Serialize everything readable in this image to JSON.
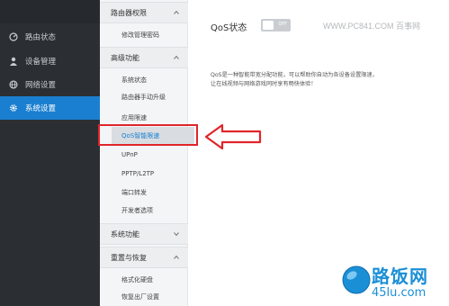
{
  "sidebar": {
    "items": [
      {
        "label": "路由状态",
        "icon": "gauge-icon"
      },
      {
        "label": "设备管理",
        "icon": "user-icon"
      },
      {
        "label": "网络设置",
        "icon": "globe-icon"
      },
      {
        "label": "系统设置",
        "icon": "gear-icon",
        "active": true
      }
    ]
  },
  "menu2": {
    "sections": [
      {
        "title": "路由器权限",
        "items": [
          "修改管理密码"
        ]
      },
      {
        "title": "高级功能",
        "items": [
          "系统状态",
          "路由器手动升级",
          "应用限速",
          "QoS智能限速",
          "UPnP",
          "PPTP/L2TP",
          "端口转发",
          "开发者选项"
        ]
      },
      {
        "title": "系统功能",
        "items": []
      },
      {
        "title": "重置与恢复",
        "items": [
          "格式化硬盘",
          "恢复出厂设置"
        ]
      }
    ],
    "selected": "QoS智能限速"
  },
  "main": {
    "qos_title": "QoS状态",
    "toggle_label": "OFF",
    "desc_line1": "QoS是一种智能带宽分配功能，可以帮助你自动为各设备设置限速，",
    "desc_line2": "让在线视频与网络游戏同时享有畅快体验！"
  },
  "watermark": "WWW.PC841.COM 百事网",
  "logo": {
    "name": "路饭网",
    "url": "45lu.com"
  },
  "colors": {
    "accent": "#1a7fd0",
    "sidebar_bg": "#2b2f33",
    "annotation": "#e0252a"
  }
}
